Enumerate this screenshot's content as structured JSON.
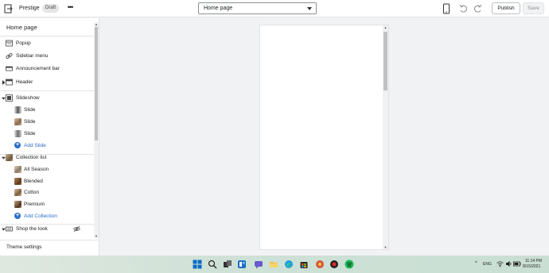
{
  "topbar": {
    "theme_name": "Prestige",
    "badge": "Draft",
    "more": "•••",
    "page_select": "Home page",
    "publish": "Publish",
    "save": "Save"
  },
  "sidebar": {
    "title": "Home page",
    "popup": "Popup",
    "sidebar_menu": "Sidebar menu",
    "announcement_bar": "Announcement bar",
    "header": "Header",
    "slideshow": "Slideshow",
    "slide_1": "Slide",
    "slide_2": "Slide",
    "slide_3": "Slide",
    "add_slide": "Add Slide",
    "collection_list": "Collection list",
    "coll_1": "All Season",
    "coll_2": "Blended",
    "coll_3": "Cotton",
    "coll_4": "Premium",
    "add_collection": "Add Collection",
    "shop_the_look": "Shop the look",
    "theme_settings": "Theme settings"
  },
  "taskbar": {
    "language": "ENG",
    "time": "11:14 PM",
    "date": "8/15/2021"
  },
  "colors": {
    "accent": "#2c6ecb",
    "border": "#dfe3e8",
    "canvas": "#f1f2f3"
  }
}
